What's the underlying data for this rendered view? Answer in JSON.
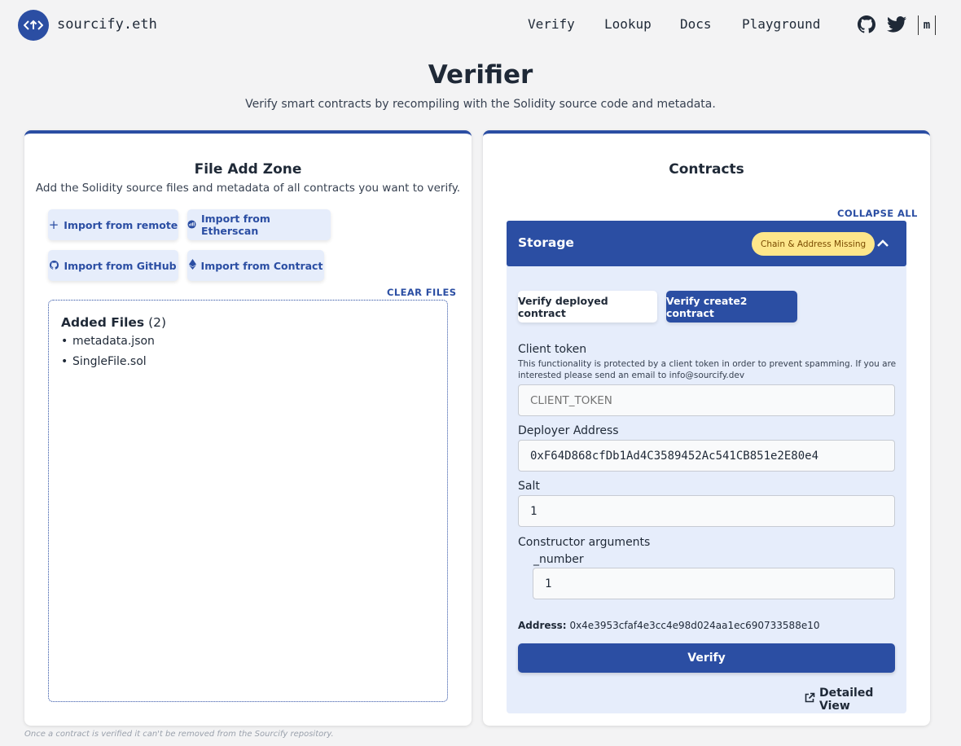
{
  "header": {
    "brand": "sourcify.eth",
    "nav": [
      "Verify",
      "Lookup",
      "Docs",
      "Playground"
    ],
    "icons": [
      "github-icon",
      "twitter-icon",
      "matrix-icon"
    ],
    "matrix_label": "m"
  },
  "page": {
    "title": "Verifier",
    "subtitle": "Verify smart contracts by recompiling with the Solidity source code and metadata."
  },
  "file_zone": {
    "title": "File Add Zone",
    "subtitle": "Add the Solidity source files and metadata of all contracts you want to verify.",
    "import_buttons": [
      "Import from remote",
      "Import from Etherscan",
      "Import from GitHub",
      "Import from Contract"
    ],
    "clear_label": "CLEAR FILES",
    "added_label": "Added Files",
    "added_count": "(2)",
    "files": [
      "metadata.json",
      "SingleFile.sol"
    ]
  },
  "contracts": {
    "title": "Contracts",
    "collapse_label": "COLLAPSE ALL",
    "contract_name": "Storage",
    "badge": "Chain & Address Missing",
    "tabs": [
      "Verify deployed contract",
      "Verify create2 contract"
    ],
    "client_token_label": "Client token",
    "client_token_help": "This functionality is protected by a client token in order to prevent spamming. If you are interested please send an email to info@sourcify.dev",
    "client_token_placeholder": "CLIENT_TOKEN",
    "deployer_label": "Deployer Address",
    "deployer_value": "0xF64D868cfDb1Ad4C3589452Ac541CB851e2E80e4",
    "salt_label": "Salt",
    "salt_value": "1",
    "ctor_label": "Constructor arguments",
    "arg_name": "_number",
    "arg_value": "1",
    "address_label": "Address:",
    "address_value": "0x4e3953cfaf4e3cc4e98d024aa1ec690733588e10",
    "verify_label": "Verify",
    "detailed_label": "Detailed View"
  },
  "footer": {
    "note": "Once a contract is verified it can't be removed from the Sourcify repository."
  },
  "colors": {
    "accent": "#2b4ea3",
    "accent_light": "#e6edfb",
    "badge_bg": "#fde68a"
  }
}
